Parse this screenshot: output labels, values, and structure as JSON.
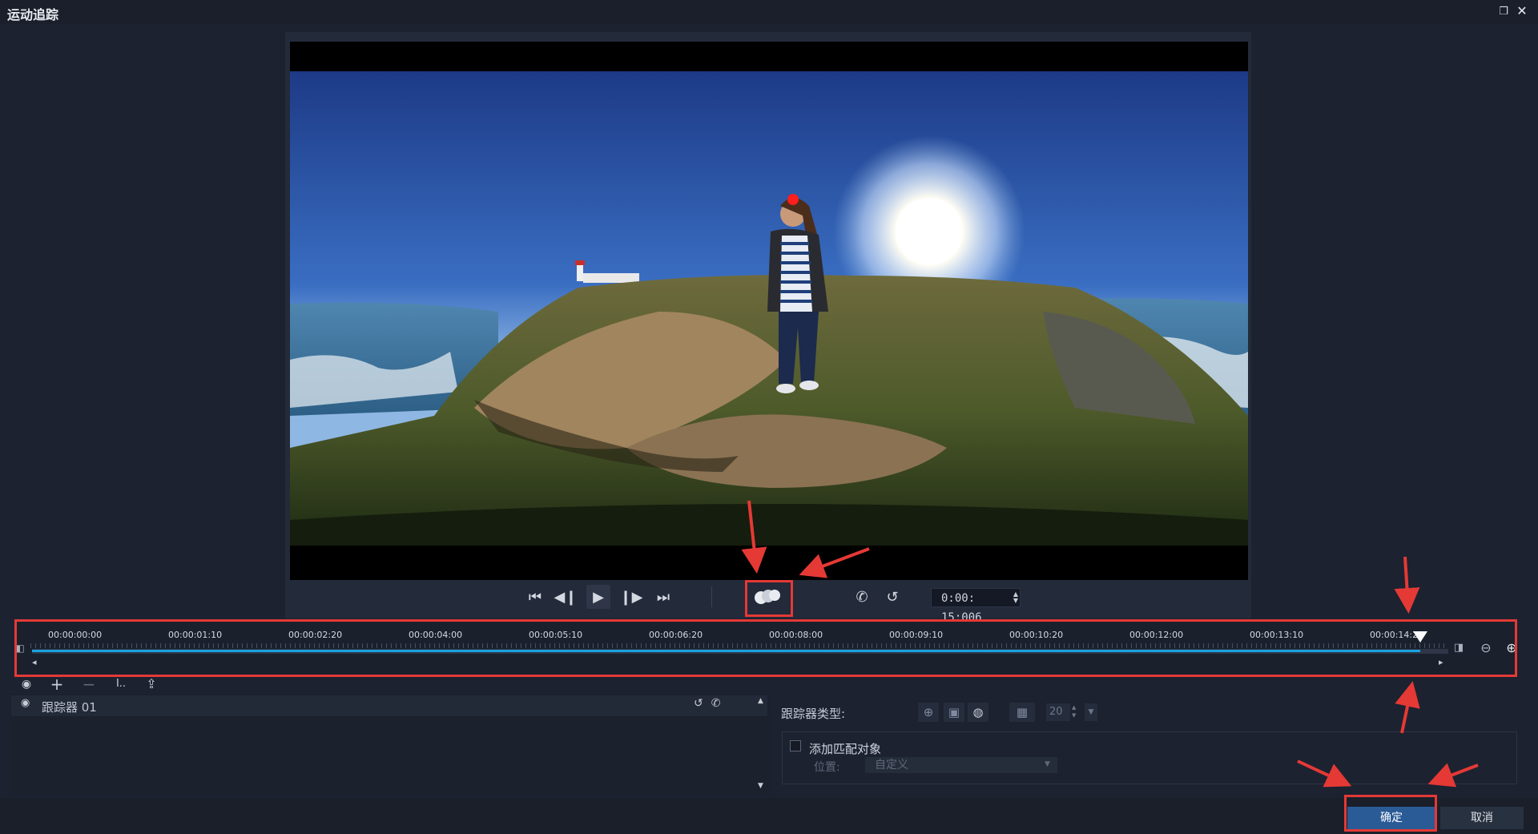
{
  "window": {
    "title": "运动追踪",
    "restore_icon": "restore-icon",
    "close_icon": "close-icon"
  },
  "player": {
    "controls": [
      "skip-to-start-icon",
      "step-back-icon",
      "play-icon",
      "step-forward-icon",
      "skip-to-end-icon"
    ],
    "track_mode_icon": "motion-track-icon",
    "timecode": "0:00: 15:006"
  },
  "timeline": {
    "ticks": [
      "00:00:00:00",
      "00:00:01:10",
      "00:00:02:20",
      "00:00:04:00",
      "00:00:05:10",
      "00:00:06:20",
      "00:00:08:00",
      "00:00:09:10",
      "00:00:10:20",
      "00:00:12:00",
      "00:00:13:10",
      "00:00:14:20"
    ],
    "playhead_fraction": 0.98
  },
  "trackers": {
    "items": [
      {
        "name": "跟踪器 01"
      }
    ]
  },
  "props": {
    "tracker_type_label": "跟踪器类型:",
    "size_value": "20",
    "match_label": "添加匹配对象",
    "position_label": "位置:",
    "position_value": "自定义"
  },
  "buttons": {
    "ok": "确定",
    "cancel": "取消"
  },
  "colors": {
    "accent": "#1aa3e0",
    "annotation": "#e53935",
    "ok_button": "#2a5b97"
  }
}
